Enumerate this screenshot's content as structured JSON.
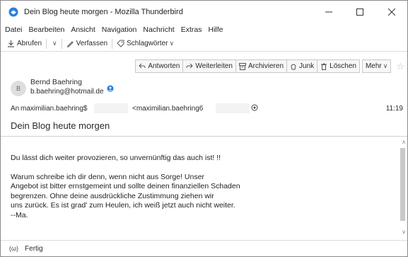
{
  "window": {
    "title": "Dein Blog heute morgen - Mozilla Thunderbird"
  },
  "menu": [
    {
      "label": "Datei"
    },
    {
      "label": "Bearbeiten"
    },
    {
      "label": "Ansicht"
    },
    {
      "label": "Navigation"
    },
    {
      "label": "Nachricht"
    },
    {
      "label": "Extras"
    },
    {
      "label": "Hilfe"
    }
  ],
  "toolbar": {
    "fetch_label": "Abrufen",
    "compose_label": "Verfassen",
    "tags_label": "Schlagwörter"
  },
  "actions": {
    "reply": "Antworten",
    "forward": "Weiterleiten",
    "archive": "Archivieren",
    "junk": "Junk",
    "delete": "Löschen",
    "more": "Mehr"
  },
  "message": {
    "avatar_initial": "B",
    "sender_name": "Bernd Baehring",
    "sender_email": "b.baehring@hotmail.de",
    "to_label": "An",
    "to_recipient": "maximilian.baehring$",
    "to_full": "<maximilian.baehring6",
    "time": "11:19",
    "subject": "Dein Blog heute morgen",
    "body": [
      "Du lässt dich weiter provozieren, so unvernünftig das auch ist! !!",
      "",
      "Warum schreibe ich dir denn, wenn nicht aus Sorge! Unser",
      "Angebot ist bitter ernstgemeint und sollte deinen finanziellen Schaden",
      "begrenzen. Ohne deine ausdrückliche Zustimmung ziehen wir",
      "uns zurück. Es ist grad' zum Heulen, ich weiß jetzt auch nicht weiter.",
      "--Ma."
    ]
  },
  "status": {
    "icon": "(ω)",
    "text": "Fertig"
  },
  "colors": {
    "thunderbird_blue": "#2a7de1",
    "border": "#c9c9c9",
    "scroll_thumb": "#c9c9c9"
  }
}
